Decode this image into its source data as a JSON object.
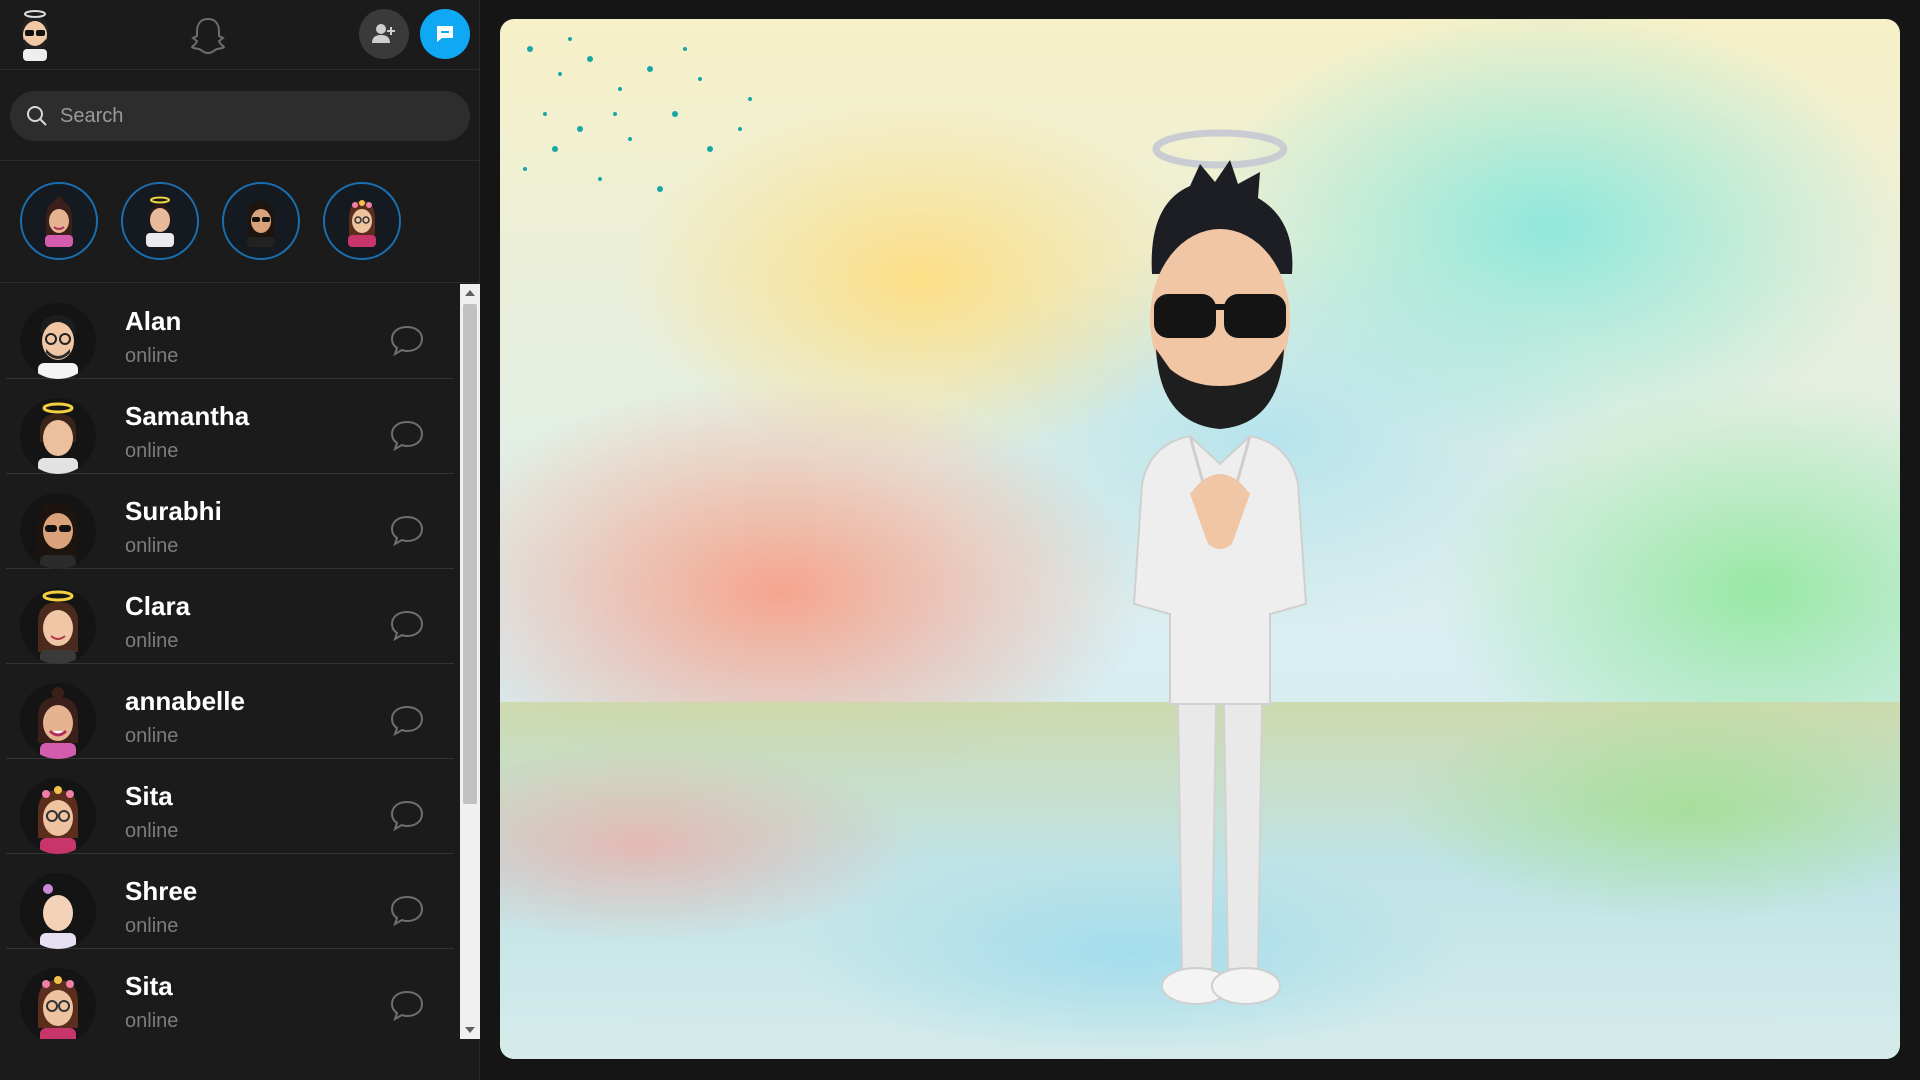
{
  "header": {
    "profile_icon": "bitmoji-avatar-icon",
    "logo_icon": "ghost-icon",
    "add_friend_icon": "add-friend-icon",
    "new_chat_icon": "new-chat-icon",
    "accent_color": "#0fa8f5"
  },
  "search": {
    "placeholder": "Search",
    "icon": "search-icon"
  },
  "stories": [
    {
      "icon": "bitmoji-avatar-icon"
    },
    {
      "icon": "bitmoji-avatar-icon"
    },
    {
      "icon": "bitmoji-avatar-icon"
    },
    {
      "icon": "bitmoji-avatar-icon"
    }
  ],
  "chats": [
    {
      "name": "Alan",
      "status": "online"
    },
    {
      "name": "Samantha",
      "status": "online"
    },
    {
      "name": "Surabhi",
      "status": "online"
    },
    {
      "name": "Clara",
      "status": "online"
    },
    {
      "name": "annabelle",
      "status": "online"
    },
    {
      "name": "Sita",
      "status": "online"
    },
    {
      "name": "Shree",
      "status": "online"
    },
    {
      "name": "Sita",
      "status": "online"
    }
  ],
  "stage": {
    "scene_icon": "bitmoji-3d-avatar"
  }
}
